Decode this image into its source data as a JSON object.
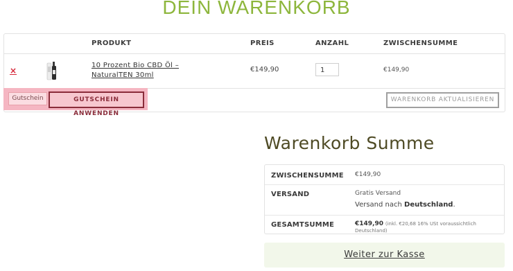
{
  "page": {
    "title": "DEIN WARENKORB"
  },
  "cart": {
    "headers": {
      "product": "PRODUKT",
      "price": "PREIS",
      "quantity": "ANZAHL",
      "subtotal": "ZWISCHENSUMME"
    },
    "items": [
      {
        "remove_symbol": "×",
        "name": "10 Prozent Bio CBD Öl – NaturalTEN 30ml",
        "price": "€149,90",
        "quantity": "1",
        "subtotal": "€149,90"
      }
    ],
    "coupon": {
      "placeholder": "Gutschein",
      "apply_label": "GUTSCHEIN ANWENDEN"
    },
    "update_label": "WARENKORB AKTUALISIEREN"
  },
  "totals": {
    "title": "Warenkorb Summe",
    "subtotal_label": "ZWISCHENSUMME",
    "subtotal_value": "€149,90",
    "shipping_label": "VERSAND",
    "shipping_method": "Gratis Versand",
    "shipping_destination_prefix": "Versand nach",
    "shipping_destination_country": "Deutschland",
    "shipping_destination_suffix": ".",
    "total_label": "GESAMTSUMME",
    "total_value": "€149,90",
    "total_tax_note": "(inkl. €20,68 16% USt voraussichtlich Deutschland)",
    "checkout_label": "Weiter zur Kasse"
  },
  "colors": {
    "accent_green": "#8db63c",
    "remove_red": "#d6283a",
    "highlight_pink": "#f5b6c2"
  }
}
